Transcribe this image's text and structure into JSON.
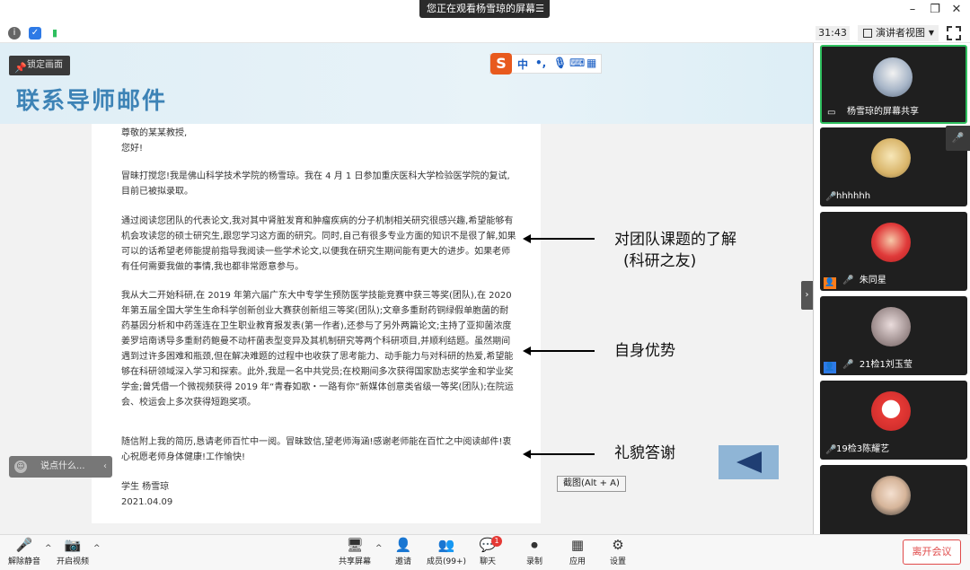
{
  "share_banner": {
    "text": "您正在观看杨雪琼的屏幕",
    "menu_icon": "menu-icon"
  },
  "toolbar": {
    "timer": "31:43",
    "view_mode": "演讲者视图"
  },
  "slide": {
    "lock_label": "锁定画面",
    "title": "联系导师邮件",
    "ime": {
      "lang": "中",
      "punct": "•,",
      "items": [
        "mic-icon",
        "keyboard-icon",
        "grid-icon"
      ]
    },
    "letter": {
      "greeting": "尊敬的某某教授,",
      "hello": "您好!",
      "p1": "冒昧打搅您!我是佛山科学技术学院的杨雪琼。我在 4 月 1 日参加重庆医科大学检验医学院的复试,目前已被拟录取。",
      "p2": "通过阅读您团队的代表论文,我对其中肾脏发育和肿瘤疾病的分子机制相关研究很感兴趣,希望能够有机会攻读您的硕士研究生,跟您学习这方面的研究。同时,自己有很多专业方面的知识不是很了解,如果可以的话希望老师能提前指导我阅读一些学术论文,以便我在研究生期间能有更大的进步。如果老师有任何需要我做的事情,我也都非常愿意参与。",
      "p3": "我从大二开始科研,在 2019 年第六届广东大中专学生预防医学技能竞赛中获三等奖(团队),在 2020 年第五届全国大学生生命科学创新创业大赛获创新组三等奖(团队);文章多重耐药铜绿假单胞菌的耐药基因分析和中药莲连在卫生职业教育报发表(第一作者),还参与了另外两篇论文;主持了亚抑菌浓度姜罗培南诱导多重耐药鲍曼不动杆菌表型变异及其机制研究等两个科研项目,并顺利结题。虽然期间遇到过许多困难和瓶颈,但在解决难题的过程中也收获了思考能力、动手能力与对科研的热爱,希望能够在科研领域深入学习和探索。此外,我是一名中共党员;在校期间多次获得国家励志奖学金和学业奖学金;曾凭借一个微视频获得 2019 年“青春如歌・一路有你”新媒体创意类省级一等奖(团队);在院运会、校运会上多次获得短跑奖项。",
      "p4": "随信附上我的简历,恳请老师百忙中一阅。冒昧致信,望老师海涵!感谢老师能在百忙之中阅读邮件!衷心祝愿老师身体健康!工作愉快!",
      "sign": "学生  杨雪琼",
      "date": "2021.04.09"
    },
    "annotations": [
      "对团队课题的了解",
      "(科研之友)",
      "自身优势",
      "礼貌答谢"
    ],
    "chat_placeholder": "说点什么...",
    "screenshot_tip": "截图(Alt + A)"
  },
  "participants": [
    {
      "name": "杨雪琼的屏幕共享",
      "status": "sharing"
    },
    {
      "name": "hhhhhh",
      "status": "muted"
    },
    {
      "name": "朱同星",
      "status": "muted",
      "badge": "host"
    },
    {
      "name": "21检1刘玉莹",
      "status": "muted",
      "badge": "cohost"
    },
    {
      "name": "19检3陈耀艺",
      "status": "muted"
    },
    {
      "name": "",
      "status": ""
    }
  ],
  "bottom": {
    "unmute": "解除静音",
    "start_video": "开启视频",
    "share": "共享屏幕",
    "invite": "邀请",
    "members": "成员(99+)",
    "chat": "聊天",
    "chat_badge": "1",
    "record": "录制",
    "apps": "应用",
    "settings": "设置",
    "leave": "离开会议"
  }
}
